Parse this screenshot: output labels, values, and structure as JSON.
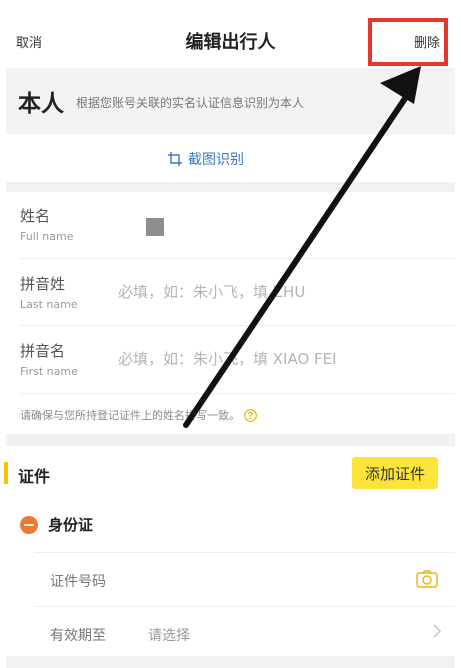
{
  "nav": {
    "cancel": "取消",
    "title": "编辑出行人",
    "delete": "删除"
  },
  "self": {
    "title": "本人",
    "description": "根据您账号关联的实名认证信息识别为本人"
  },
  "scan": {
    "label": "截图识别"
  },
  "fields": [
    {
      "label": "姓名",
      "sub": "Full name",
      "placeholder": ""
    },
    {
      "label": "拼音姓",
      "sub": "Last name",
      "placeholder": "必填，如：朱小飞，填 ZHU"
    },
    {
      "label": "拼音名",
      "sub": "First name",
      "placeholder": "必填，如：朱小飞，填 XIAO FEI"
    }
  ],
  "tip": "请确保与您所持登记证件上的姓名拼写一致。",
  "certificate": {
    "title": "证件",
    "add_button": "添加证件",
    "type": "身份证",
    "number_label": "证件号码",
    "expiry_label": "有效期至",
    "expiry_placeholder": "请选择"
  },
  "colors": {
    "highlight_red": "#e8352e",
    "accent_yellow": "#fde43c",
    "link_blue": "#3a78c8",
    "remove_orange": "#f0772f"
  }
}
